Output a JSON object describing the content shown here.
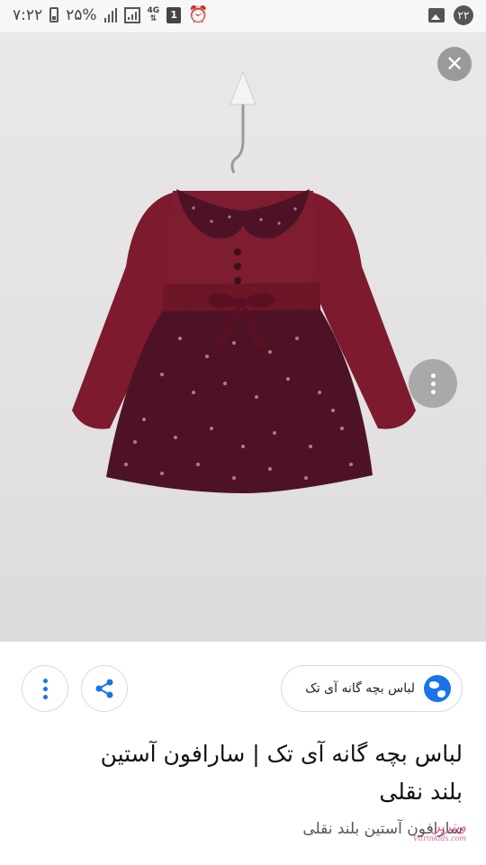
{
  "status_bar": {
    "time": "۷:۲۲",
    "battery_percent": "۲۵%",
    "network": "4G",
    "sim_slot": "1",
    "notification_count": "۲۲"
  },
  "viewer": {
    "image_description_icon": "dress-image",
    "close_icon": "close-icon",
    "more_icon": "more-vert-icon"
  },
  "source": {
    "chip_label": "لباس بچه گانه آی تک",
    "title": "لباس بچه گانه آی تک | سارافون آستین بلند نقلی",
    "subtitle": "سارافون آستین بلند نقلی",
    "watermark": "ویترین",
    "watermark_url": "Vitrinkids.com"
  },
  "colors": {
    "dress_red": "#7d1a2e",
    "dress_skirt": "#4e1226",
    "accent_blue": "#1a73e8"
  }
}
